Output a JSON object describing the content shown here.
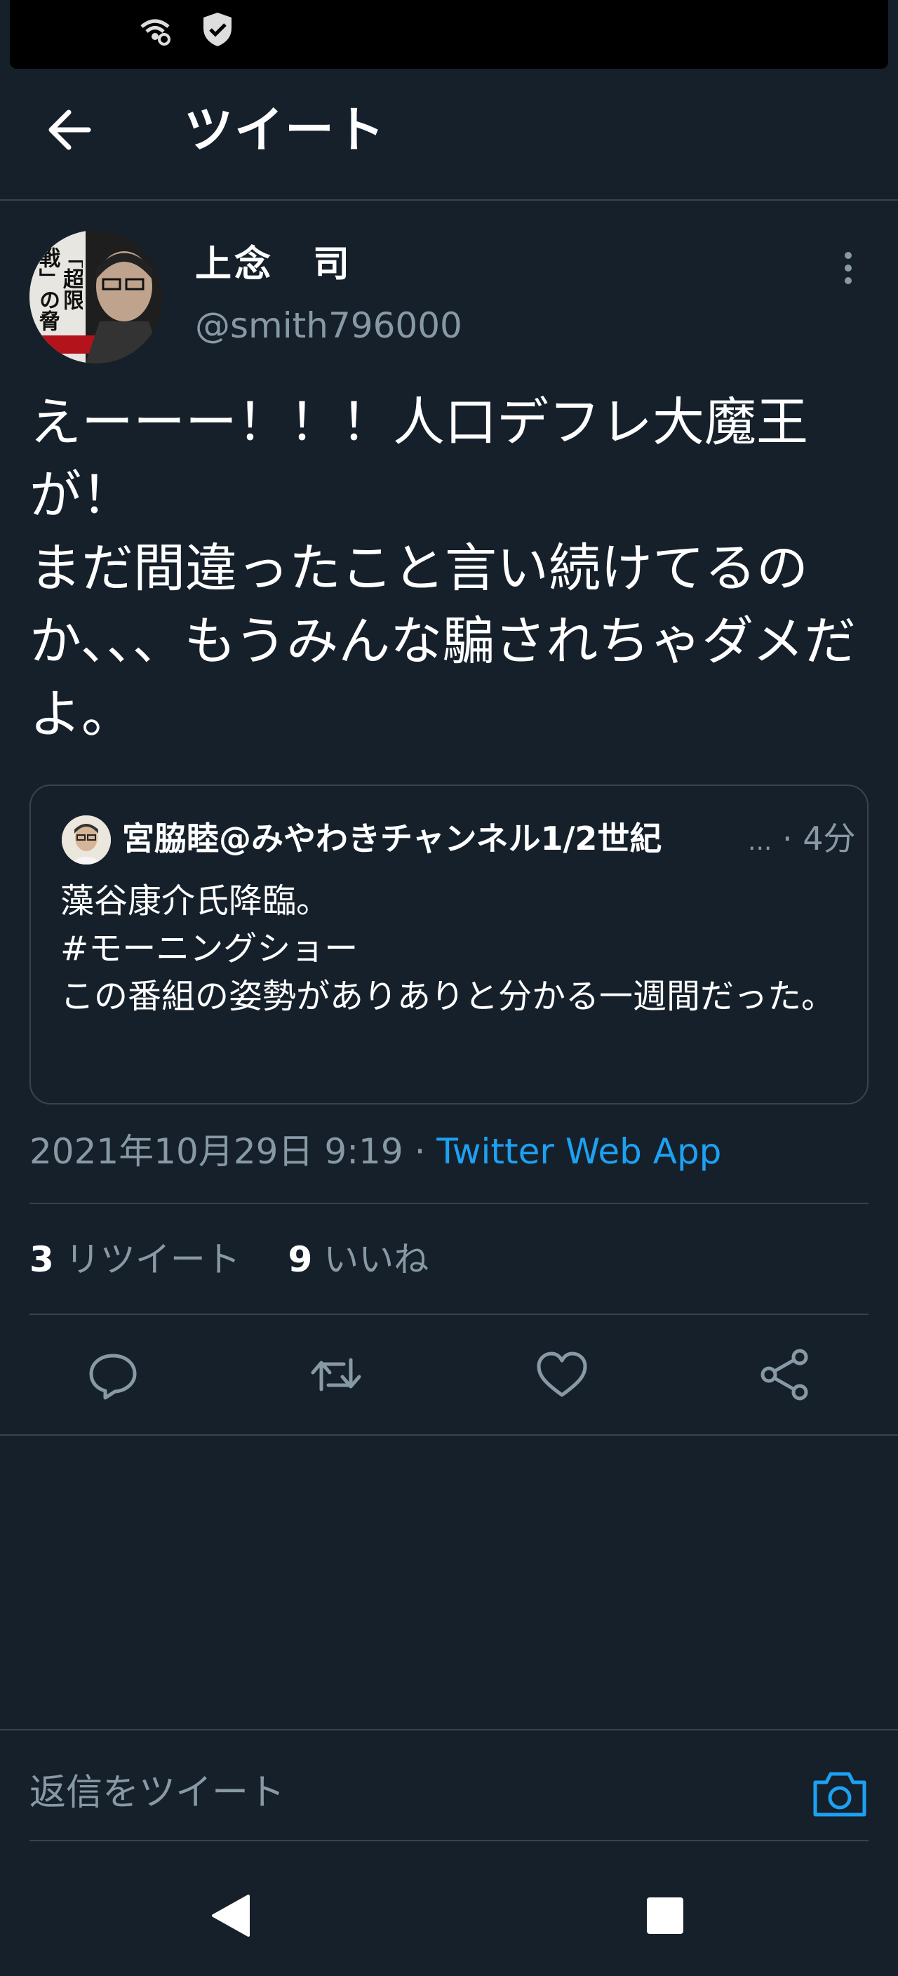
{
  "header": {
    "title": "ツイート"
  },
  "author": {
    "name": "上念　司",
    "handle": "@smith796000",
    "avatar_text": "「超限戦」の脅威"
  },
  "tweet": {
    "text": "えーーー！！！人口デフレ大魔王が！\nまだ間違ったこと言い続けてるのか、、、もうみんな騙されちゃダメだよ。"
  },
  "quote": {
    "name": "宮脇睦@みやわきチャンネル1/2世紀",
    "ellipsis": "...",
    "time": "4分",
    "text": "藻谷康介氏降臨。\n#モーニングショー\nこの番組の姿勢がありありと分かる一週間だった。"
  },
  "meta": {
    "timestamp": "2021年10月29日 9:19",
    "separator": " · ",
    "source": "Twitter Web App"
  },
  "stats": {
    "retweets_count": "3",
    "retweets_label": "リツイート",
    "likes_count": "9",
    "likes_label": "いいね"
  },
  "reply": {
    "placeholder": "返信をツイート"
  },
  "colors": {
    "background": "#15202b",
    "accent": "#1da1f2",
    "muted": "#8899a6",
    "border": "#38444d"
  },
  "icons": [
    "wifi-calling-icon",
    "shield-check-icon",
    "back-arrow-icon",
    "more-vertical-icon",
    "reply-icon",
    "retweet-icon",
    "like-icon",
    "share-icon",
    "camera-icon",
    "nav-back-icon",
    "nav-recents-icon"
  ]
}
